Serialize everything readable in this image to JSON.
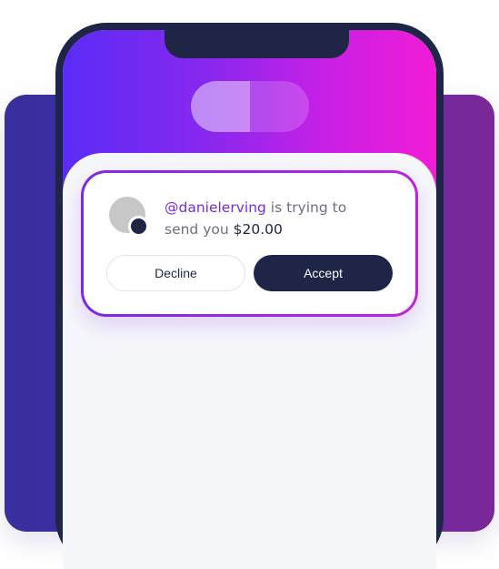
{
  "notification": {
    "handle": "@danielerving",
    "message_middle": " is trying to send you ",
    "amount": "$20.00"
  },
  "buttons": {
    "decline_label": "Decline",
    "accept_label": "Accept"
  },
  "colors": {
    "brand_purple": "#7a2ae6",
    "brand_pink": "#f21cd6",
    "navy": "#1e2547",
    "muted_text": "#6b6f80"
  }
}
